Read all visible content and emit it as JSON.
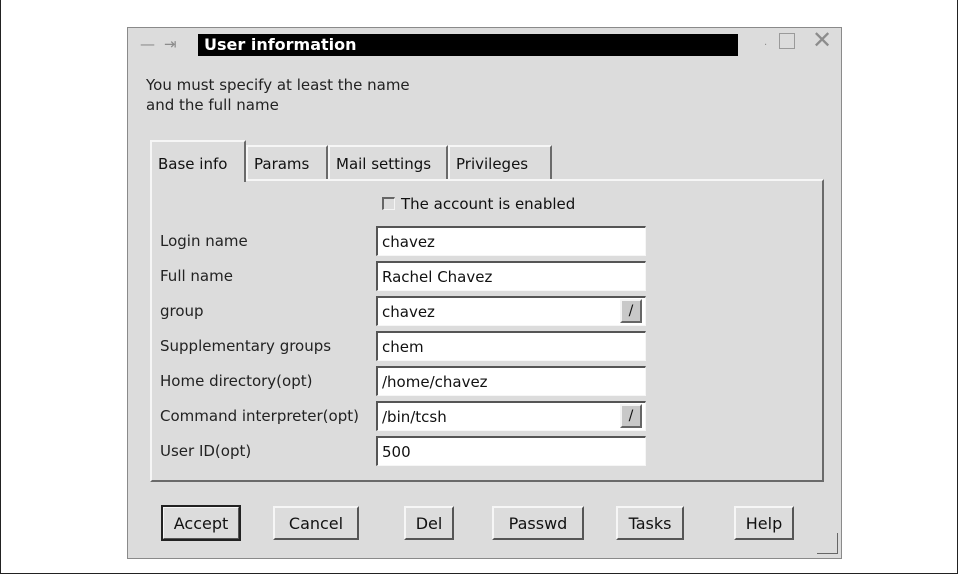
{
  "window": {
    "title": "User information",
    "controls": {
      "menu_glyph": "—",
      "pin_glyph": "⇥",
      "minimize_glyph": "·",
      "close_glyph": "✕"
    }
  },
  "instruction": "You must specify at least the name\nand the full name",
  "tabs": [
    {
      "label": "Base info",
      "active": true
    },
    {
      "label": "Params",
      "active": false
    },
    {
      "label": "Mail settings",
      "active": false
    },
    {
      "label": "Privileges",
      "active": false
    }
  ],
  "form": {
    "account_enabled": {
      "label": "The account is enabled",
      "checked": false
    },
    "fields": [
      {
        "label": "Login name",
        "value": "chavez",
        "type": "text"
      },
      {
        "label": "Full name",
        "value": "Rachel Chavez",
        "type": "text"
      },
      {
        "label": "group",
        "value": "chavez",
        "type": "combo"
      },
      {
        "label": "Supplementary groups",
        "value": "chem",
        "type": "text"
      },
      {
        "label": "Home directory(opt)",
        "value": "/home/chavez",
        "type": "text"
      },
      {
        "label": "Command interpreter(opt)",
        "value": "/bin/tcsh",
        "type": "combo"
      },
      {
        "label": "User ID(opt)",
        "value": "500",
        "type": "text"
      }
    ],
    "combo_glyph": "/"
  },
  "buttons": {
    "accept": "Accept",
    "cancel": "Cancel",
    "del": "Del",
    "passwd": "Passwd",
    "tasks": "Tasks",
    "help": "Help"
  }
}
